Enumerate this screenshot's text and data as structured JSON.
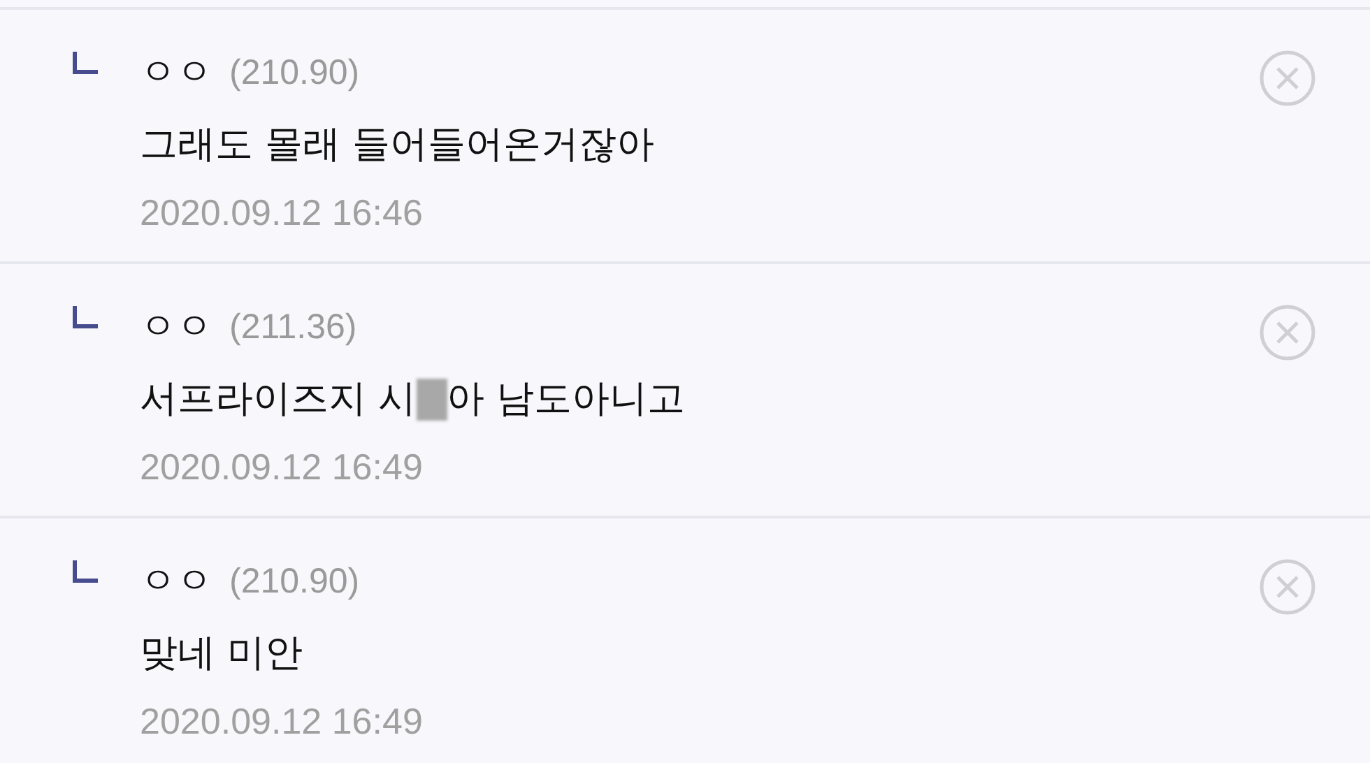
{
  "comments": [
    {
      "name": "ㅇㅇ",
      "ip": "(210.90)",
      "segments": [
        {
          "kind": "text",
          "text": "그래도 몰래 들어들어온거잖아"
        }
      ],
      "date": "2020.09.12 16:46"
    },
    {
      "name": "ㅇㅇ",
      "ip": "(211.36)",
      "segments": [
        {
          "kind": "text",
          "text": "서프라이즈지 시"
        },
        {
          "kind": "censored"
        },
        {
          "kind": "text",
          "text": "아 남도아니고"
        }
      ],
      "date": "2020.09.12 16:49"
    },
    {
      "name": "ㅇㅇ",
      "ip": "(210.90)",
      "segments": [
        {
          "kind": "text",
          "text": "맞네 미안"
        }
      ],
      "date": "2020.09.12 16:49"
    }
  ]
}
